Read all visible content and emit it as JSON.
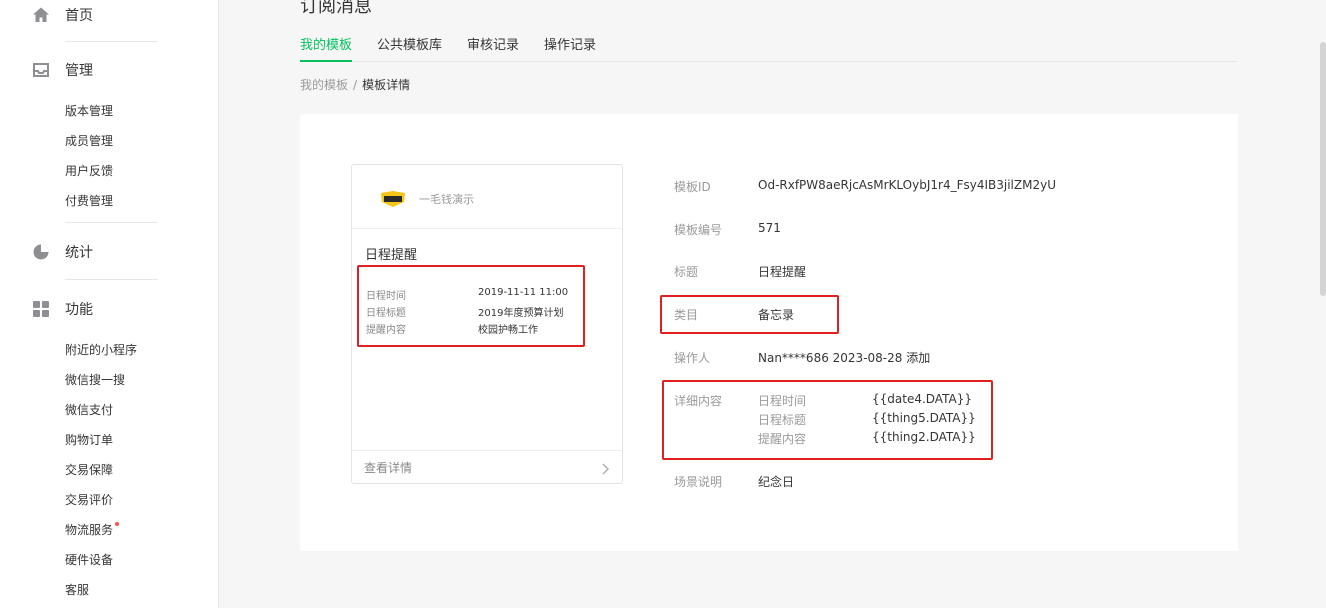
{
  "sidebar": {
    "home": "首页",
    "manage": "管理",
    "manage_items": [
      "版本管理",
      "成员管理",
      "用户反馈",
      "付费管理"
    ],
    "stats": "统计",
    "features": "功能",
    "feature_items": [
      "附近的小程序",
      "微信搜一搜",
      "微信支付",
      "购物订单",
      "交易保障",
      "交易评价",
      "物流服务",
      "硬件设备",
      "客服"
    ]
  },
  "page": {
    "title": "订阅消息",
    "tabs": [
      "我的模板",
      "公共模板库",
      "审核记录",
      "操作记录"
    ],
    "active_tab": "我的模板",
    "breadcrumb": {
      "parent": "我的模板",
      "separator": "/",
      "current": "模板详情"
    }
  },
  "preview": {
    "app_logo_text": "一毛钱",
    "app_name": "一毛钱演示",
    "title": "日程提醒",
    "rows": [
      {
        "label": "日程时间",
        "value": "2019-11-11 11:00"
      },
      {
        "label": "日程标题",
        "value": "2019年度预算计划"
      },
      {
        "label": "提醒内容",
        "value": "校园护畅工作"
      }
    ],
    "footer_link": "查看详情"
  },
  "detail": {
    "template_id_label": "模板ID",
    "template_id": "Od-RxfPW8aeRjcAsMrKLOybJ1r4_Fsy4IB3jilZM2yU",
    "template_no_label": "模板编号",
    "template_no": "571",
    "title_label": "标题",
    "title": "日程提醒",
    "category_label": "类目",
    "category": "备忘录",
    "operator_label": "操作人",
    "operator": "Nan****686 2023-08-28 添加",
    "content_label": "详细内容",
    "content_rows": [
      {
        "label": "日程时间",
        "value": "{{date4.DATA}}"
      },
      {
        "label": "日程标题",
        "value": "{{thing5.DATA}}"
      },
      {
        "label": "提醒内容",
        "value": "{{thing2.DATA}}"
      }
    ],
    "scene_label": "场景说明",
    "scene": "纪念日"
  },
  "colors": {
    "accent": "#07c160",
    "highlight": "#e02020",
    "text": "#353535",
    "muted": "#9a9a9a",
    "notice_dot": "#fa5151"
  },
  "icons": [
    "home-icon",
    "inbox-icon",
    "pie-chart-icon",
    "grid-icon",
    "chevron-right-icon",
    "app-logo-icon"
  ]
}
